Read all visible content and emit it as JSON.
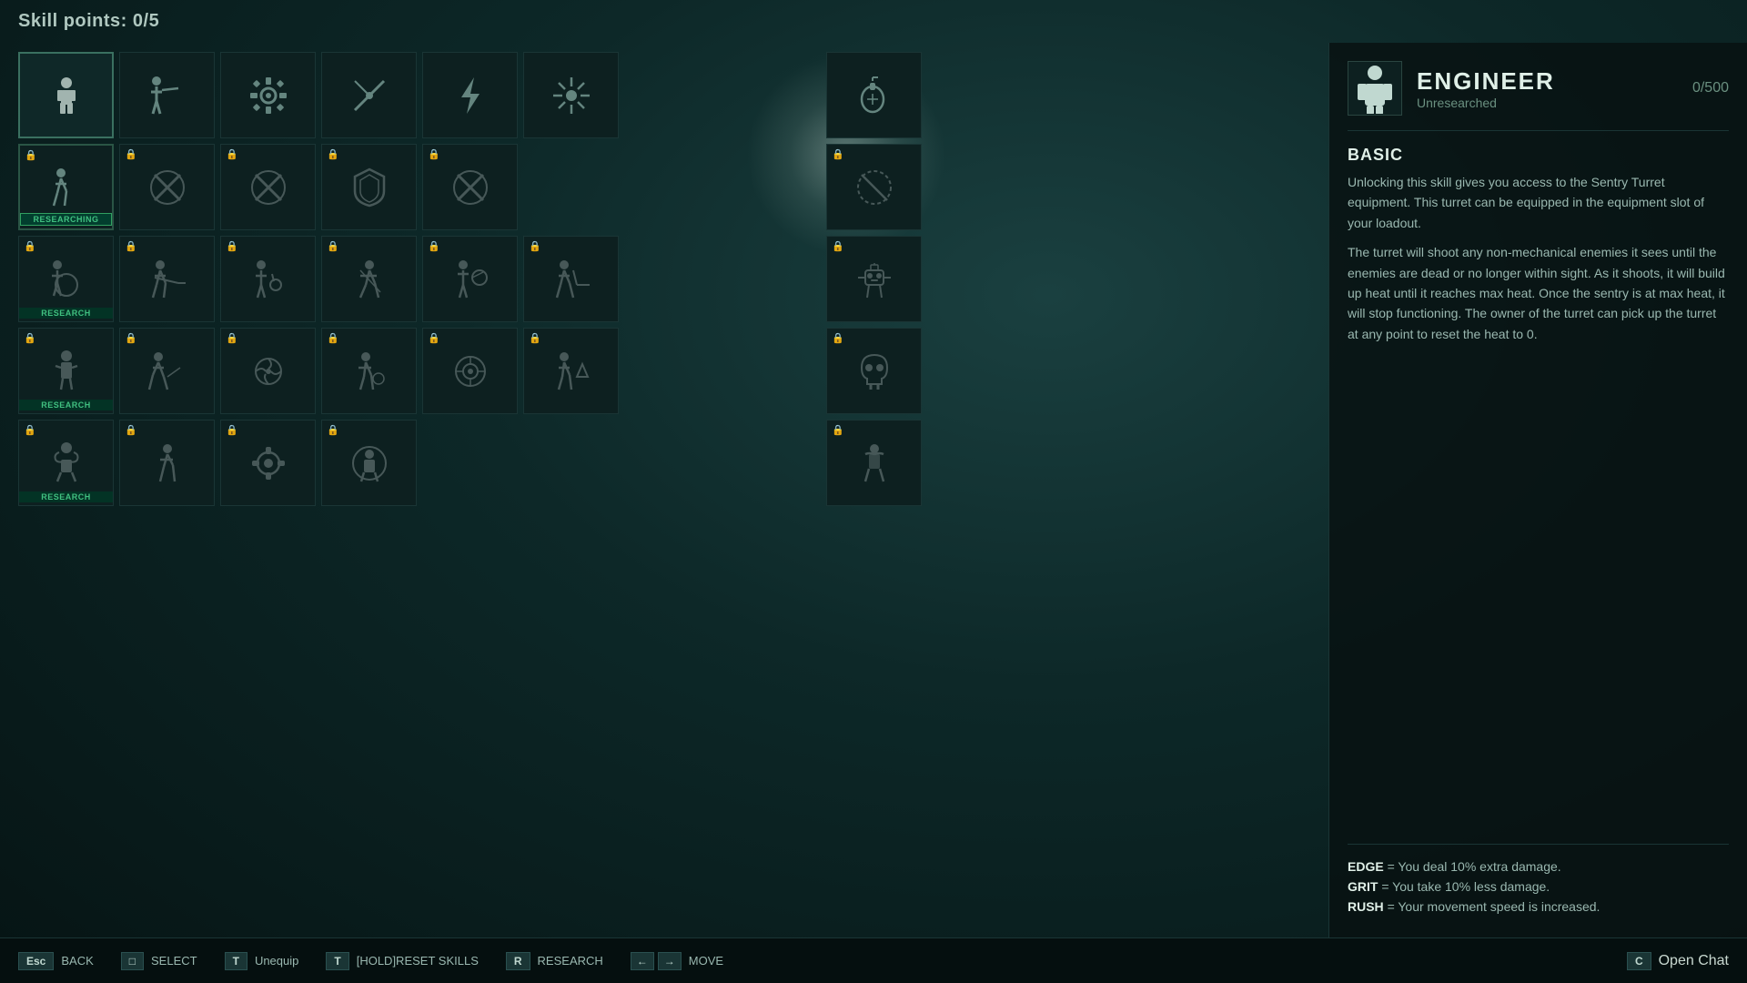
{
  "header": {
    "skill_points_label": "Skill points: 0/5"
  },
  "right_panel": {
    "character": {
      "name": "ENGINEER",
      "status": "Unresearched",
      "score": "0/500"
    },
    "section_title": "BASIC",
    "description_1": "Unlocking this skill gives you access to the Sentry Turret equipment. This turret can be equipped in the equipment slot of your loadout.",
    "description_2": "The turret will shoot any non-mechanical enemies it sees until the enemies are dead or no longer within sight. As it shoots, it will build up heat until it reaches max heat. Once the sentry is at max heat, it will stop functioning. The owner of the turret can pick up the turret at any point to reset the heat to 0.",
    "stats": [
      {
        "name": "EDGE",
        "desc": " = You deal 10% extra damage."
      },
      {
        "name": "GRIT",
        "desc": " = You take 10% less damage."
      },
      {
        "name": "RUSH",
        "desc": " = Your movement speed is increased."
      }
    ]
  },
  "bottom_bar": {
    "back_key": "Esc",
    "back_label": "BACK",
    "select_key": "□",
    "select_label": "SELECT",
    "unequip_key": "T",
    "unequip_label": "Unequip",
    "reset_key": "T",
    "reset_label": "[HOLD]RESET SKILLS",
    "research_key": "R",
    "research_label": "RESEARCH",
    "move_label": "MOVE",
    "chat_key": "C",
    "chat_label": "Open Chat"
  },
  "rows": [
    {
      "id": "row1",
      "cells": [
        {
          "id": "r1c1",
          "icon": "person-white",
          "label": "",
          "locked": false,
          "selected": true
        },
        {
          "id": "r1c2",
          "icon": "person-shoot",
          "label": "",
          "locked": false,
          "selected": false
        },
        {
          "id": "r1c3",
          "icon": "gear",
          "label": "",
          "locked": false,
          "selected": false
        },
        {
          "id": "r1c4",
          "icon": "sword-slash",
          "label": "",
          "locked": false,
          "selected": false
        },
        {
          "id": "r1c5",
          "icon": "lightning",
          "label": "",
          "locked": false,
          "selected": false
        },
        {
          "id": "r1c6",
          "icon": "burst",
          "label": "",
          "locked": false,
          "selected": false
        },
        {
          "id": "r1c7",
          "icon": "",
          "label": "",
          "locked": false,
          "selected": false,
          "empty": true
        },
        {
          "id": "r1c8",
          "icon": "",
          "label": "",
          "locked": false,
          "selected": false,
          "empty": true
        },
        {
          "id": "r1c9",
          "icon": "grenade",
          "label": "",
          "locked": false,
          "selected": false
        }
      ]
    },
    {
      "id": "row2",
      "cells": [
        {
          "id": "r2c1",
          "icon": "person-run",
          "label": "RESEARCHING",
          "locked": true,
          "researching": true
        },
        {
          "id": "r2c2",
          "icon": "cross",
          "label": "",
          "locked": true,
          "selected": false
        },
        {
          "id": "r2c3",
          "icon": "cross2",
          "label": "",
          "locked": true,
          "selected": false
        },
        {
          "id": "r2c4",
          "icon": "shield",
          "label": "",
          "locked": true,
          "selected": false
        },
        {
          "id": "r2c5",
          "icon": "cross3",
          "label": "",
          "locked": true,
          "selected": false
        },
        {
          "id": "r2c6",
          "icon": "",
          "label": "",
          "locked": false,
          "selected": false,
          "empty": true
        },
        {
          "id": "r2c7",
          "icon": "",
          "label": "",
          "locked": false,
          "selected": false,
          "empty": true
        },
        {
          "id": "r2c8",
          "icon": "",
          "label": "",
          "locked": false,
          "selected": false,
          "empty": true
        },
        {
          "id": "r2c9",
          "icon": "circle-dash",
          "label": "",
          "locked": true,
          "selected": false
        }
      ]
    },
    {
      "id": "row3",
      "cells": [
        {
          "id": "r3c1",
          "icon": "person-globe",
          "label": "RESEARCH",
          "locked": true
        },
        {
          "id": "r3c2",
          "icon": "run-slash",
          "label": "",
          "locked": true
        },
        {
          "id": "r3c3",
          "icon": "fight",
          "label": "",
          "locked": true
        },
        {
          "id": "r3c4",
          "icon": "person-spin",
          "label": "",
          "locked": true
        },
        {
          "id": "r3c5",
          "icon": "fight2",
          "label": "",
          "locked": true
        },
        {
          "id": "r3c6",
          "icon": "fight3",
          "label": "",
          "locked": true
        },
        {
          "id": "r3c7",
          "icon": "",
          "label": "",
          "locked": false,
          "selected": false,
          "empty": true
        },
        {
          "id": "r3c8",
          "icon": "",
          "label": "",
          "locked": false,
          "selected": false,
          "empty": true
        },
        {
          "id": "r3c9",
          "icon": "robot",
          "label": "",
          "locked": true
        }
      ]
    },
    {
      "id": "row4",
      "cells": [
        {
          "id": "r4c1",
          "icon": "person-coat",
          "label": "RESEARCH",
          "locked": true
        },
        {
          "id": "r4c2",
          "icon": "run-right",
          "label": "",
          "locked": true
        },
        {
          "id": "r4c3",
          "icon": "spin",
          "label": "",
          "locked": true
        },
        {
          "id": "r4c4",
          "icon": "person-fire",
          "label": "",
          "locked": true
        },
        {
          "id": "r4c5",
          "icon": "circle-target",
          "label": "",
          "locked": true
        },
        {
          "id": "r4c6",
          "icon": "fight-star",
          "label": "",
          "locked": true
        },
        {
          "id": "r4c7",
          "icon": "",
          "label": "",
          "locked": false,
          "selected": false,
          "empty": true
        },
        {
          "id": "r4c8",
          "icon": "",
          "label": "",
          "locked": false,
          "selected": false,
          "empty": true
        },
        {
          "id": "r4c9",
          "icon": "skull",
          "label": "",
          "locked": true
        }
      ]
    },
    {
      "id": "row5",
      "cells": [
        {
          "id": "r5c1",
          "icon": "cowboy",
          "label": "RESEARCH",
          "locked": true
        },
        {
          "id": "r5c2",
          "icon": "run-left",
          "label": "",
          "locked": true
        },
        {
          "id": "r5c3",
          "icon": "circle-gear",
          "label": "",
          "locked": true
        },
        {
          "id": "r5c4",
          "icon": "person-circle",
          "label": "",
          "locked": true
        },
        {
          "id": "r5c5",
          "icon": "",
          "label": "",
          "locked": false,
          "empty": true
        },
        {
          "id": "r5c6",
          "icon": "",
          "label": "",
          "locked": false,
          "empty": true
        },
        {
          "id": "r5c7",
          "icon": "",
          "label": "",
          "locked": false,
          "empty": true
        },
        {
          "id": "r5c8",
          "icon": "",
          "label": "",
          "locked": false,
          "empty": true
        },
        {
          "id": "r5c9",
          "icon": "cowboy2",
          "label": "",
          "locked": true
        }
      ]
    }
  ]
}
